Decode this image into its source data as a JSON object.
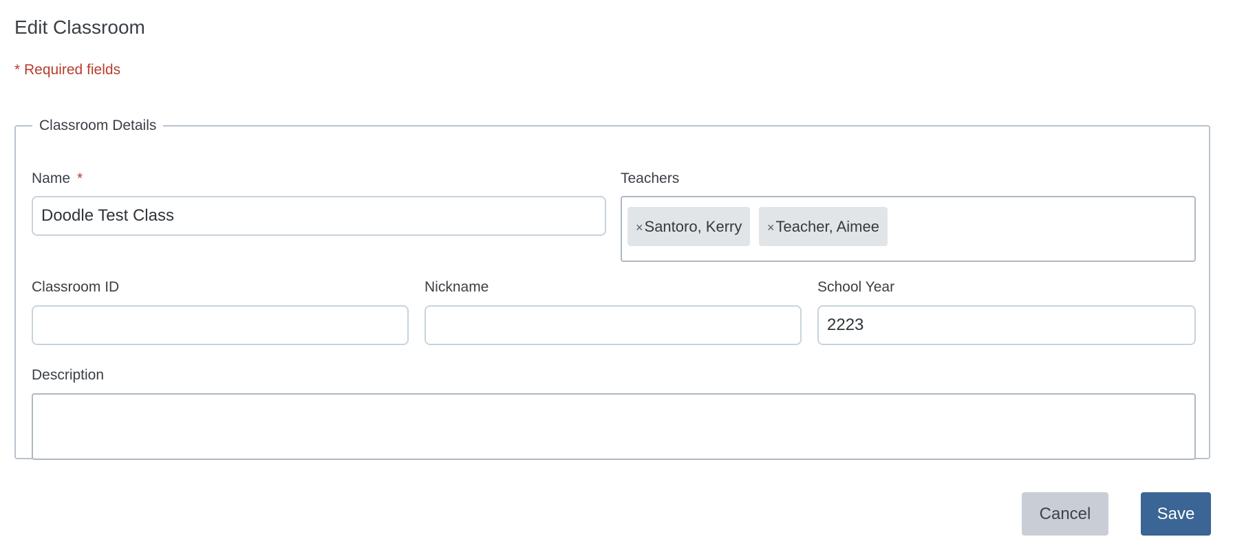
{
  "page": {
    "title": "Edit Classroom",
    "required_note": "* Required fields"
  },
  "fieldset": {
    "legend": "Classroom Details"
  },
  "fields": {
    "name": {
      "label": "Name",
      "required_mark": "*",
      "value": "Doodle Test Class"
    },
    "teachers": {
      "label": "Teachers",
      "tags": [
        {
          "remove": "×",
          "label": "Santoro, Kerry"
        },
        {
          "remove": "×",
          "label": "Teacher, Aimee"
        }
      ]
    },
    "classroom_id": {
      "label": "Classroom ID",
      "value": ""
    },
    "nickname": {
      "label": "Nickname",
      "value": ""
    },
    "school_year": {
      "label": "School Year",
      "value": "2223"
    },
    "description": {
      "label": "Description",
      "value": ""
    }
  },
  "actions": {
    "cancel_label": "Cancel",
    "save_label": "Save"
  },
  "colors": {
    "required": "#b83b2d",
    "primary": "#3a6594",
    "secondary": "#c9ced6"
  }
}
